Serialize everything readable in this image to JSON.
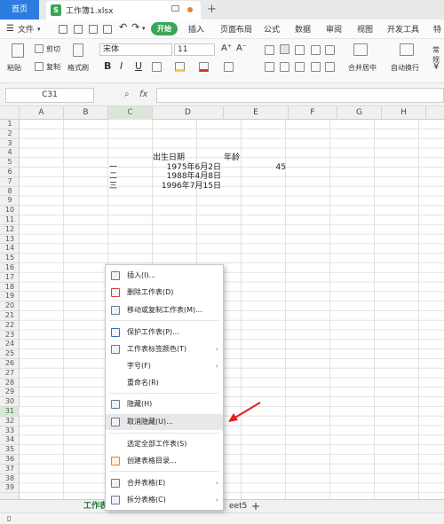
{
  "tabs": {
    "home": "首页",
    "doc": "工作簿1.xlsx",
    "doc_icon": "S",
    "new_tab": "+"
  },
  "menu": {
    "file": "文件",
    "start": "开始",
    "items": [
      "插入",
      "页面布局",
      "公式",
      "数据",
      "审阅",
      "视图",
      "开发工具",
      "特"
    ]
  },
  "ribbon": {
    "paste": "粘贴",
    "cut": "剪切",
    "copy": "复制",
    "format_painter": "格式刷",
    "font_name": "宋体",
    "font_size": "11",
    "bold": "B",
    "italic": "I",
    "underline": "U",
    "grow": "A⁺",
    "shrink": "A⁻",
    "merge": "合并居中",
    "wrap": "自动换行",
    "normal": "常规",
    "percent": "¥"
  },
  "formula": {
    "cell_ref": "C31",
    "fx": "fx",
    "zoom": "Q",
    "value": ""
  },
  "columns": [
    "A",
    "B",
    "C",
    "D",
    "E",
    "F",
    "G",
    "H"
  ],
  "rows": [
    "1",
    "2",
    "3",
    "4",
    "5",
    "6",
    "7",
    "8",
    "9",
    "10",
    "11",
    "12",
    "13",
    "14",
    "15",
    "16",
    "17",
    "18",
    "19",
    "20",
    "21",
    "22",
    "23",
    "24",
    "25",
    "26",
    "27",
    "28",
    "29",
    "30",
    "31",
    "32",
    "33",
    "34",
    "35",
    "36",
    "37",
    "38",
    "39"
  ],
  "cells": {
    "D4": "出生日期",
    "E4": "年龄",
    "C5": "一",
    "D5": "1975年6月2日",
    "E5": "45",
    "C6": "二",
    "D6": "1988年4月8日",
    "C7": "三",
    "D7": "1996年7月15日"
  },
  "context_menu": [
    {
      "label": "插入(I)...",
      "icon": "insert-sheet-icon",
      "arrow": false
    },
    {
      "label": "删除工作表(D)",
      "icon": "delete-sheet-icon",
      "arrow": false
    },
    {
      "label": "移动或复制工作表(M)...",
      "icon": "move-copy-sheet-icon",
      "arrow": false
    },
    {
      "label": "保护工作表(P)...",
      "icon": "protect-sheet-icon",
      "arrow": false
    },
    {
      "label": "工作表标签颜色(T)",
      "icon": "tab-color-icon",
      "arrow": true
    },
    {
      "label": "字号(F)",
      "icon": "",
      "arrow": true
    },
    {
      "label": "重命名(R)",
      "icon": "",
      "arrow": false
    },
    {
      "label": "隐藏(H)",
      "icon": "hide-sheet-icon",
      "arrow": false
    },
    {
      "label": "取消隐藏(U)...",
      "icon": "unhide-sheet-icon",
      "arrow": false
    },
    {
      "label": "选定全部工作表(S)",
      "icon": "",
      "arrow": false
    },
    {
      "label": "创建表格目录...",
      "icon": "table-directory-icon",
      "arrow": false
    },
    {
      "label": "合并表格(E)",
      "icon": "merge-tables-icon",
      "arrow": true
    },
    {
      "label": "拆分表格(C)",
      "icon": "split-tables-icon",
      "arrow": true
    }
  ],
  "sheets": {
    "active": "工作表",
    "other": "eet5",
    "add": "+"
  },
  "colors": {
    "accent": "#3aa655",
    "home_tab": "#2d7de0",
    "arrow": "#e02020"
  }
}
